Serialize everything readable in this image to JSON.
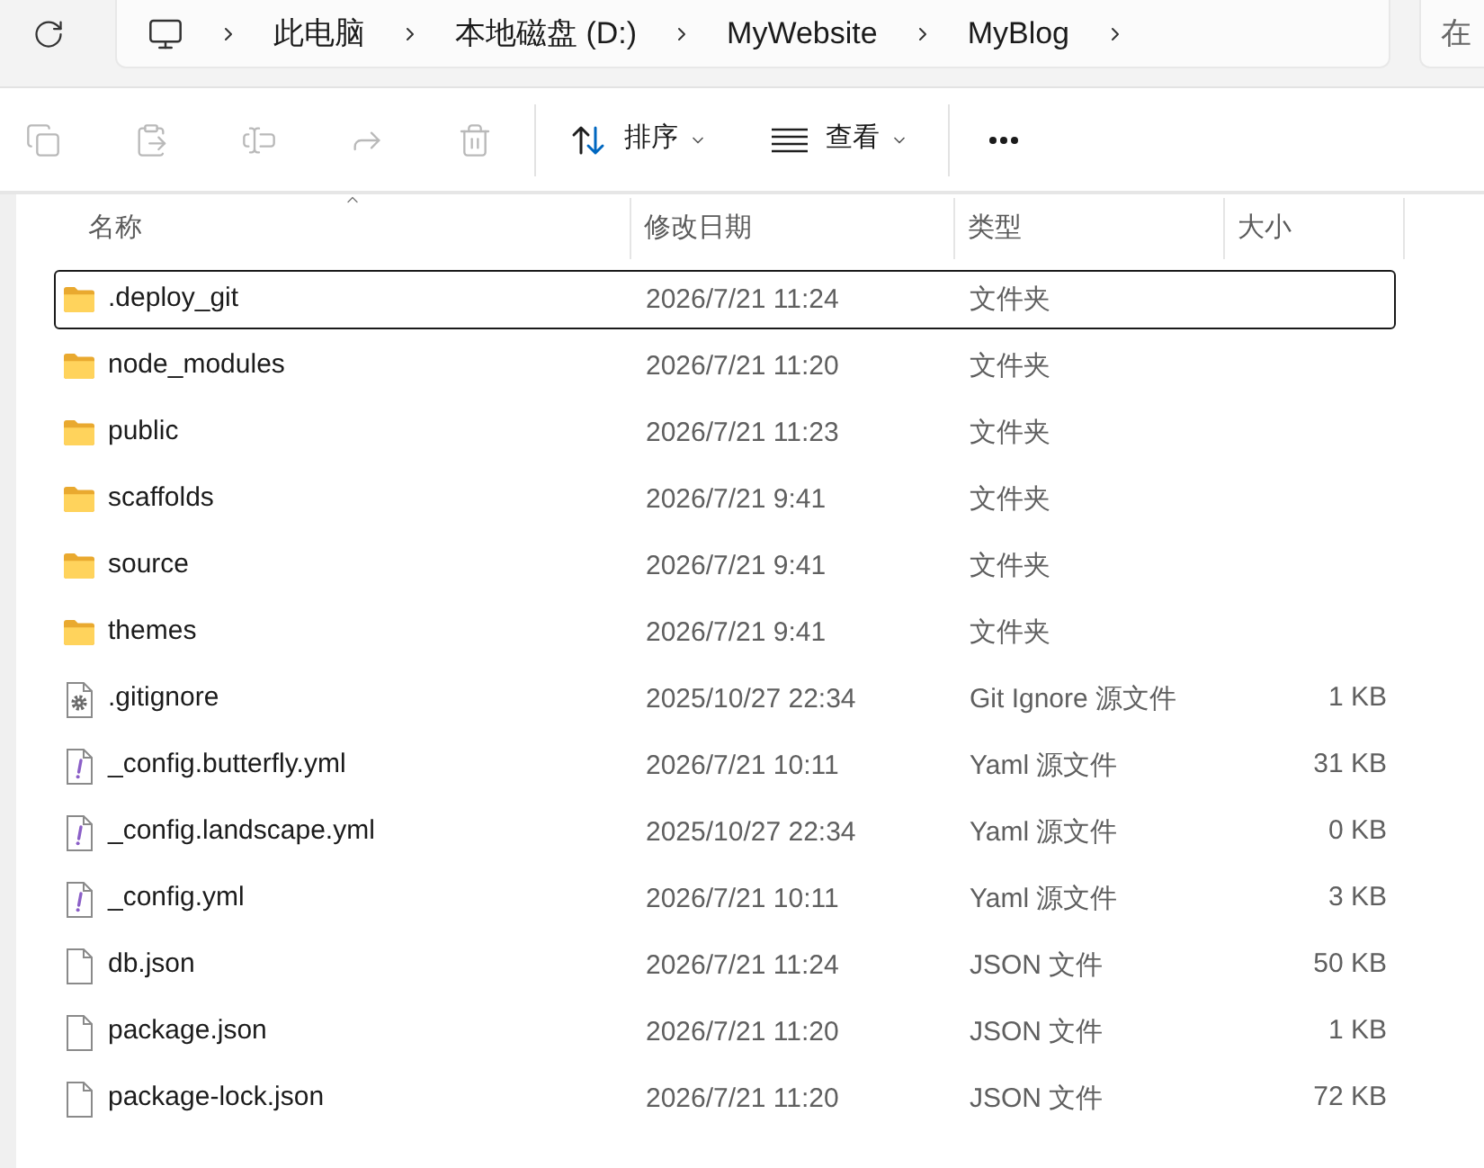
{
  "address_bar": {
    "items": [
      "此电脑",
      "本地磁盘 (D:)",
      "MyWebsite",
      "MyBlog"
    ]
  },
  "search": {
    "placeholder": "在"
  },
  "commands": [
    {
      "kind": "copy",
      "disabled": true
    },
    {
      "kind": "paste",
      "disabled": true
    },
    {
      "kind": "rename",
      "disabled": true
    },
    {
      "kind": "share",
      "disabled": true
    },
    {
      "kind": "delete",
      "disabled": true
    }
  ],
  "sort_button": {
    "label": "排序"
  },
  "view_button": {
    "label": "查看"
  },
  "columns": [
    {
      "label": "名称",
      "sorted": true
    },
    {
      "label": "修改日期",
      "sorted": false
    },
    {
      "label": "类型",
      "sorted": false
    },
    {
      "label": "大小",
      "sorted": false
    }
  ],
  "rows": [
    {
      "kind": "folder",
      "name": ".deploy_git",
      "modified": "2026/7/21 11:24",
      "type": "文件夹",
      "focused": true
    },
    {
      "kind": "folder",
      "name": "node_modules",
      "modified": "2026/7/21 11:20",
      "type": "文件夹",
      "focused": false
    },
    {
      "kind": "folder",
      "name": "public",
      "modified": "2026/7/21 11:23",
      "type": "文件夹",
      "focused": false
    },
    {
      "kind": "folder",
      "name": "scaffolds",
      "modified": "2026/7/21 9:41",
      "type": "文件夹",
      "focused": false
    },
    {
      "kind": "folder",
      "name": "source",
      "modified": "2026/7/21 9:41",
      "type": "文件夹",
      "focused": false
    },
    {
      "kind": "folder",
      "name": "themes",
      "modified": "2026/7/21 9:41",
      "type": "文件夹",
      "focused": false
    },
    {
      "kind": "settings",
      "name": ".gitignore",
      "modified": "2025/10/27 22:34",
      "type": "Git Ignore 源文件",
      "size": "1 KB",
      "focused": false
    },
    {
      "kind": "yaml",
      "name": "_config.butterfly.yml",
      "modified": "2026/7/21 10:11",
      "type": "Yaml 源文件",
      "size": "31 KB",
      "focused": false
    },
    {
      "kind": "yaml",
      "name": "_config.landscape.yml",
      "modified": "2025/10/27 22:34",
      "type": "Yaml 源文件",
      "size": "0 KB",
      "focused": false
    },
    {
      "kind": "yaml",
      "name": "_config.yml",
      "modified": "2026/7/21 10:11",
      "type": "Yaml 源文件",
      "size": "3 KB",
      "focused": false
    },
    {
      "kind": "plain",
      "name": "db.json",
      "modified": "2026/7/21 11:24",
      "type": "JSON 文件",
      "size": "50 KB",
      "focused": false
    },
    {
      "kind": "plain",
      "name": "package.json",
      "modified": "2026/7/21 11:20",
      "type": "JSON 文件",
      "size": "1 KB",
      "focused": false
    },
    {
      "kind": "plain",
      "name": "package-lock.json",
      "modified": "2026/7/21 11:20",
      "type": "JSON 文件",
      "size": "72 KB",
      "focused": false
    }
  ]
}
